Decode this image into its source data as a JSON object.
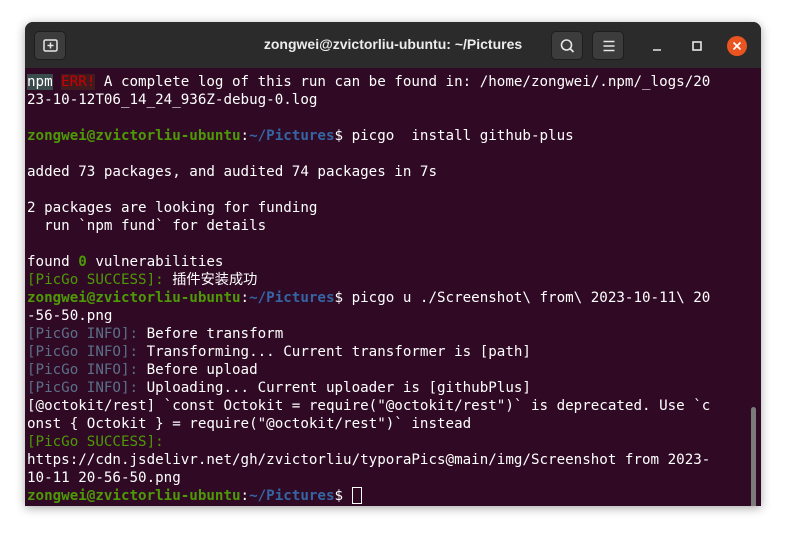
{
  "window": {
    "title": "zongwei@zvictorliu-ubuntu: ~/Pictures"
  },
  "titlebar": {
    "new_tab_icon": "new-tab-icon",
    "search_icon": "search-icon",
    "menu_icon": "hamburger-menu-icon",
    "minimize_icon": "minimize-icon",
    "maximize_icon": "maximize-icon",
    "close_icon": "close-icon"
  },
  "terminal": {
    "line1": {
      "npm": "npm",
      "err": "ERR!",
      "rest": " A complete log of this run can be found in: /home/zongwei/.npm/_logs/20"
    },
    "line2": "23-10-12T06_14_24_936Z-debug-0.log",
    "prompt1": {
      "user": "zongwei@zvictorliu-ubuntu",
      "colon": ":",
      "path": "~/Pictures",
      "dollar": "$",
      "command": " picgo  install github-plus"
    },
    "added": "added 73 packages, and audited 74 packages in 7s",
    "funding1": "2 packages are looking for funding",
    "funding2": "  run `npm fund` for details",
    "found": {
      "pre": "found ",
      "zero": "0",
      "post": " vulnerabilities"
    },
    "success1": {
      "tag": "[PicGo SUCCESS]:",
      "msg": " 插件安装成功"
    },
    "prompt2": {
      "user": "zongwei@zvictorliu-ubuntu",
      "colon": ":",
      "path": "~/Pictures",
      "dollar": "$",
      "command": " picgo u ./Screenshot\\ from\\ 2023-10-11\\ 20"
    },
    "prompt2_cont": "-56-50.png",
    "info1": {
      "tag": "[PicGo INFO]:",
      "msg": " Before transform"
    },
    "info2": {
      "tag": "[PicGo INFO]:",
      "msg": " Transforming... Current transformer is [path]"
    },
    "info3": {
      "tag": "[PicGo INFO]:",
      "msg": " Before upload"
    },
    "info4": {
      "tag": "[PicGo INFO]:",
      "msg": " Uploading... Current uploader is [githubPlus]"
    },
    "deprecation1": "[@octokit/rest] `const Octokit = require(\"@octokit/rest\")` is deprecated. Use `c",
    "deprecation2": "onst { Octokit } = require(\"@octokit/rest\")` instead",
    "success2_tag": "[PicGo SUCCESS]:",
    "url1": "https://cdn.jsdelivr.net/gh/zvictorliu/typoraPics@main/img/Screenshot from 2023-",
    "url2": "10-11 20-56-50.png",
    "prompt3": {
      "user": "zongwei@zvictorliu-ubuntu",
      "colon": ":",
      "path": "~/Pictures",
      "dollar": "$ "
    }
  }
}
